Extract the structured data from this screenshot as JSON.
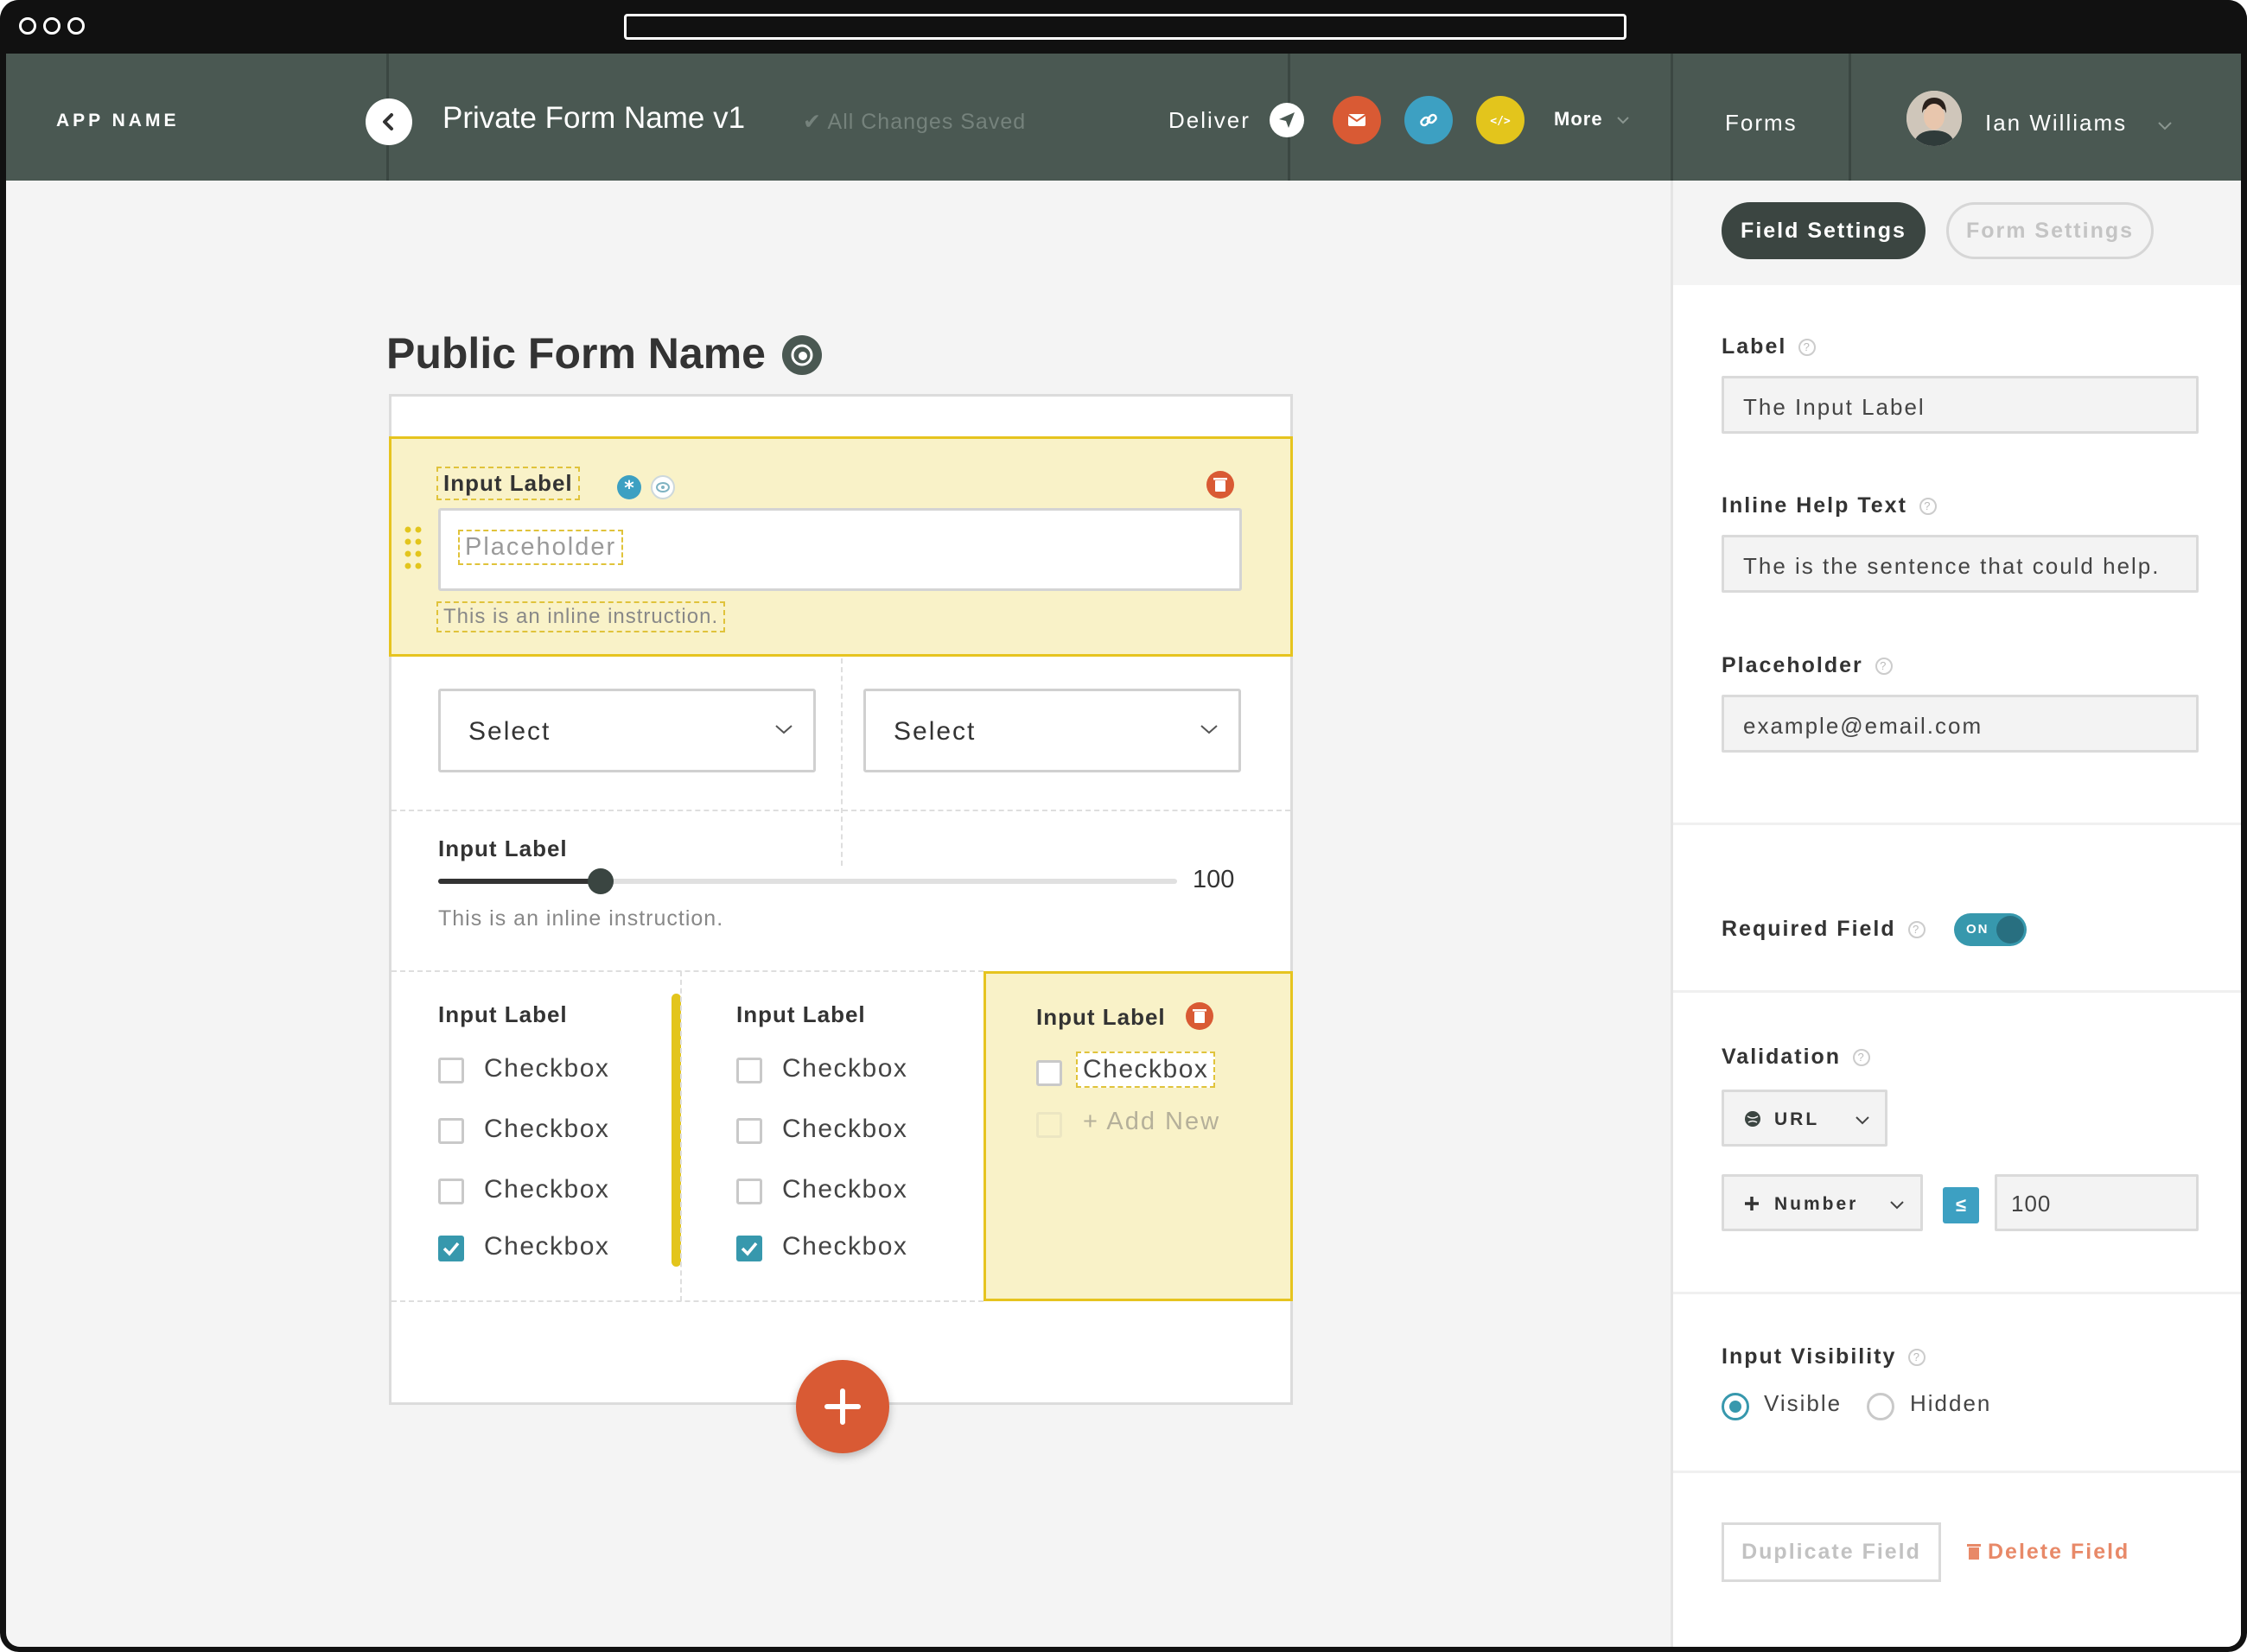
{
  "header": {
    "app_name": "APP NAME",
    "form_name": "Private Form Name v1",
    "save_status": "✔ All Changes Saved",
    "deliver_label": "Deliver",
    "more_label": "More",
    "forms_label": "Forms",
    "user_name": "Ian Williams"
  },
  "canvas": {
    "public_form_name": "Public Form Name",
    "field1": {
      "label": "Input Label",
      "placeholder": "Placeholder",
      "instruction": "This is an inline instruction."
    },
    "selects": [
      "Select",
      "Select"
    ],
    "slider": {
      "label": "Input Label",
      "value": "100",
      "instruction": "This is an inline instruction.",
      "fraction": 0.22
    },
    "checkbox_groups": [
      {
        "label": "Input Label",
        "items": [
          {
            "text": "Checkbox",
            "checked": false
          },
          {
            "text": "Checkbox",
            "checked": false
          },
          {
            "text": "Checkbox",
            "checked": false
          },
          {
            "text": "Checkbox",
            "checked": true
          }
        ]
      },
      {
        "label": "Input Label",
        "items": [
          {
            "text": "Checkbox",
            "checked": false
          },
          {
            "text": "Checkbox",
            "checked": false
          },
          {
            "text": "Checkbox",
            "checked": false
          },
          {
            "text": "Checkbox",
            "checked": true
          }
        ]
      },
      {
        "label": "Input Label",
        "items": [
          {
            "text": "Checkbox",
            "checked": false
          }
        ],
        "add_new": "+ Add New"
      }
    ],
    "add_button": "+"
  },
  "panel": {
    "tabs": {
      "field_settings": "Field Settings",
      "form_settings": "Form Settings"
    },
    "label": {
      "title": "Label",
      "value": "The Input Label"
    },
    "help": {
      "title": "Inline Help Text",
      "value": "The is the sentence that could help."
    },
    "placeholder": {
      "title": "Placeholder",
      "value": "example@email.com"
    },
    "required": {
      "title": "Required Field",
      "toggle": "ON"
    },
    "validation": {
      "title": "Validation",
      "type": "URL",
      "rule": "Number",
      "operator": "≤",
      "value": "100"
    },
    "visibility": {
      "title": "Input Visibility",
      "options": [
        "Visible",
        "Hidden"
      ],
      "selected": "Visible"
    },
    "duplicate_label": "Duplicate Field",
    "delete_label": "Delete Field"
  },
  "colors": {
    "header_bg": "#4a5852",
    "highlight_bg": "#f9f2c8",
    "highlight_border": "#e6c41f",
    "accent_teal": "#3798ad",
    "accent_red": "#d95a34",
    "accent_yellow": "#e3c51c"
  }
}
